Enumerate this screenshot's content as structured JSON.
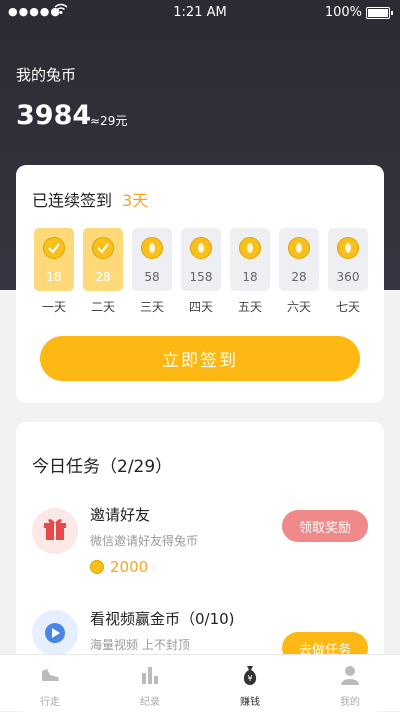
{
  "status_bar": {
    "signal": "●●●●●",
    "time": "1:21 AM",
    "battery": "100%"
  },
  "coins": {
    "title": "我的兔币",
    "total": "3984",
    "value": "≈29元"
  },
  "sign_in": {
    "streak_label": "已连续签到",
    "streak_days": "3天",
    "days": [
      {
        "label": "一天",
        "amount": "18",
        "done": true
      },
      {
        "label": "二天",
        "amount": "28",
        "done": true
      },
      {
        "label": "三天",
        "amount": "58",
        "done": false
      },
      {
        "label": "四天",
        "amount": "158",
        "done": false
      },
      {
        "label": "五天",
        "amount": "18",
        "done": false
      },
      {
        "label": "六天",
        "amount": "28",
        "done": false
      },
      {
        "label": "七天",
        "amount": "360",
        "done": false
      }
    ],
    "button_label": "立即签到"
  },
  "tasks": {
    "header": "今日任务（2/29）",
    "items": [
      {
        "title": "邀请好友",
        "desc": "微信邀请好友得兔币",
        "reward": "2000",
        "button": "领取奖励",
        "icon": "gift-icon"
      },
      {
        "title": "看视频赢金币（0/10)",
        "desc": "海量视频 上不封顶",
        "button": "去做任务",
        "icon": "play-icon"
      }
    ]
  },
  "tabbar": {
    "items": [
      {
        "label": "行走",
        "icon": "shoe-icon"
      },
      {
        "label": "纪录",
        "icon": "chart-icon"
      },
      {
        "label": "赚钱",
        "icon": "money-bag-icon"
      },
      {
        "label": "我的",
        "icon": "user-icon"
      }
    ],
    "active": "赚钱"
  },
  "colors": {
    "accent": "#fdb813",
    "header_bg": "#2a2b33",
    "claim_button": "#f08a8a",
    "highlight_text": "#f5a623"
  }
}
